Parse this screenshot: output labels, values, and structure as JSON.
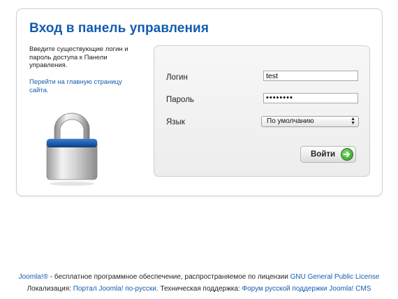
{
  "panel": {
    "title": "Вход в панель управления",
    "intro": "Введите существующие логин и пароль доступа к Панели управления.",
    "home_link": "Перейти на главную страницу сайта."
  },
  "form": {
    "username_label": "Логин",
    "username_value": "test",
    "password_label": "Пароль",
    "password_value": "••••••••",
    "language_label": "Язык",
    "language_selected": "По умолчанию",
    "submit_label": "Войти"
  },
  "icons": {
    "lock": "lock-icon",
    "submit": "green-arrow-icon"
  },
  "colors": {
    "accent": "#135cae",
    "lock_band": "#1c5fb0",
    "button_icon": "#3aa625"
  },
  "footer": {
    "line1_brand": "Joomla!®",
    "line1_text": " - бесплатное программное обеспечение, распространяемое по лицензии ",
    "line1_license": "GNU General Public License",
    "line2_loc_label": "Локализация: ",
    "line2_loc_link": "Портал Joomla! по-русски",
    "line2_support_label": ". Техническая поддержка: ",
    "line2_support_link": "Форум русской поддержки Joomla! CMS"
  }
}
